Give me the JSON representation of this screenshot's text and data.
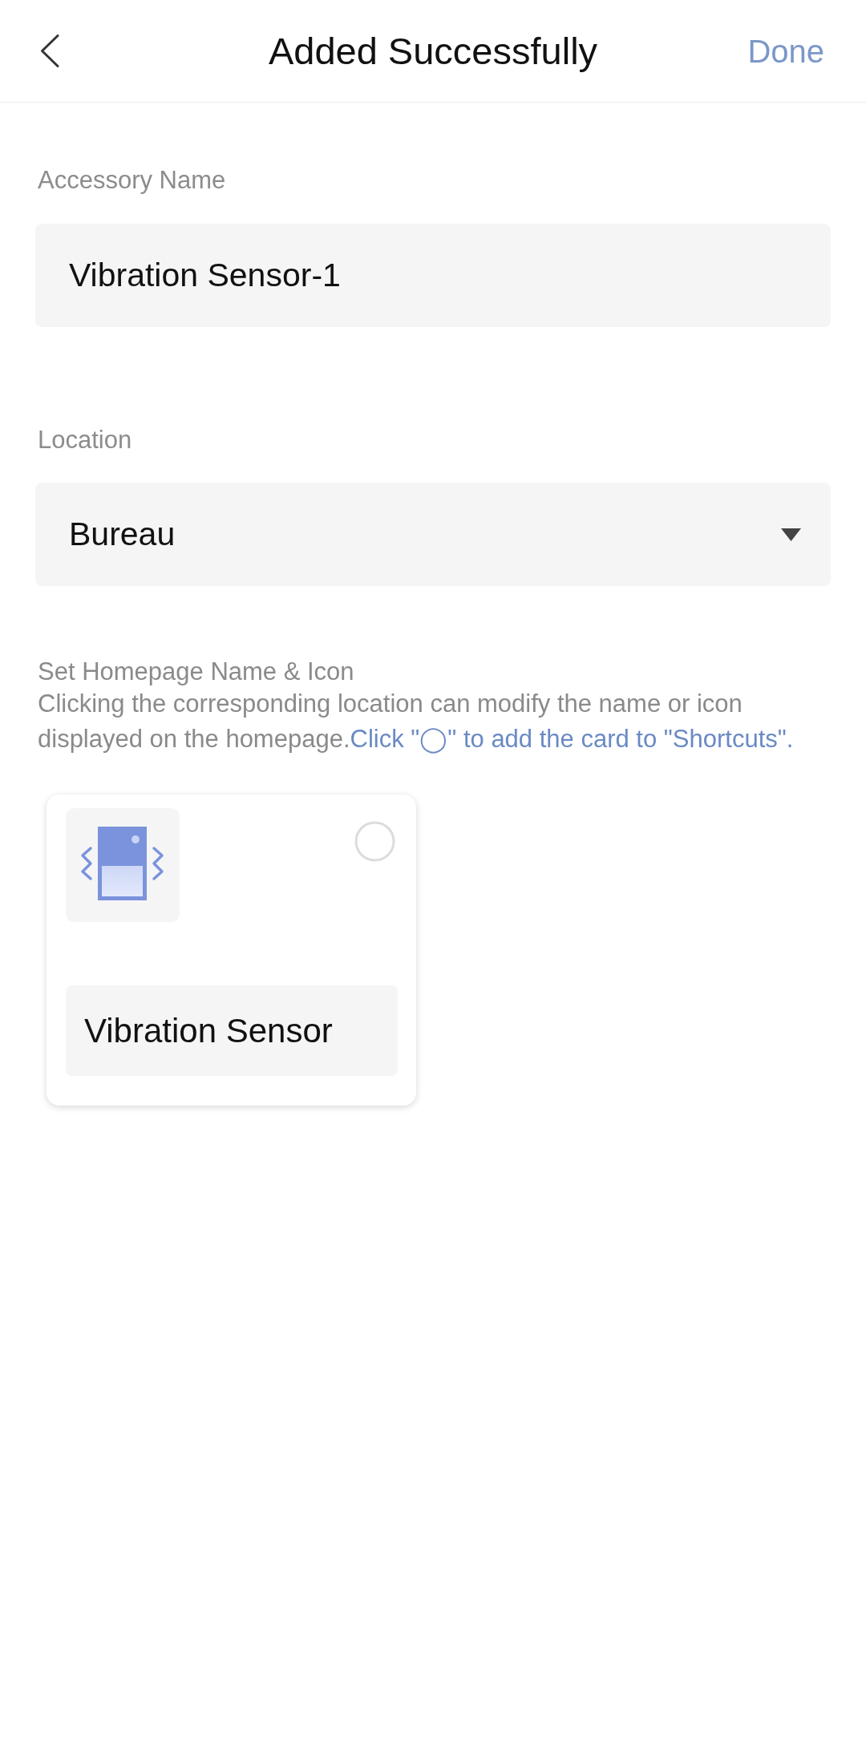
{
  "header": {
    "title": "Added Successfully",
    "action": "Done"
  },
  "accessory_name": {
    "label": "Accessory Name",
    "value": "Vibration Sensor-1"
  },
  "location": {
    "label": "Location",
    "value": "Bureau"
  },
  "homepage": {
    "title": "Set Homepage Name & Icon",
    "description": "Clicking the corresponding location can modify the name or icon displayed on the homepage.",
    "link": "Click \"◯\" to add the card to \"Shortcuts\".",
    "cards": [
      {
        "name": "Vibration Sensor",
        "checked": false
      }
    ]
  }
}
